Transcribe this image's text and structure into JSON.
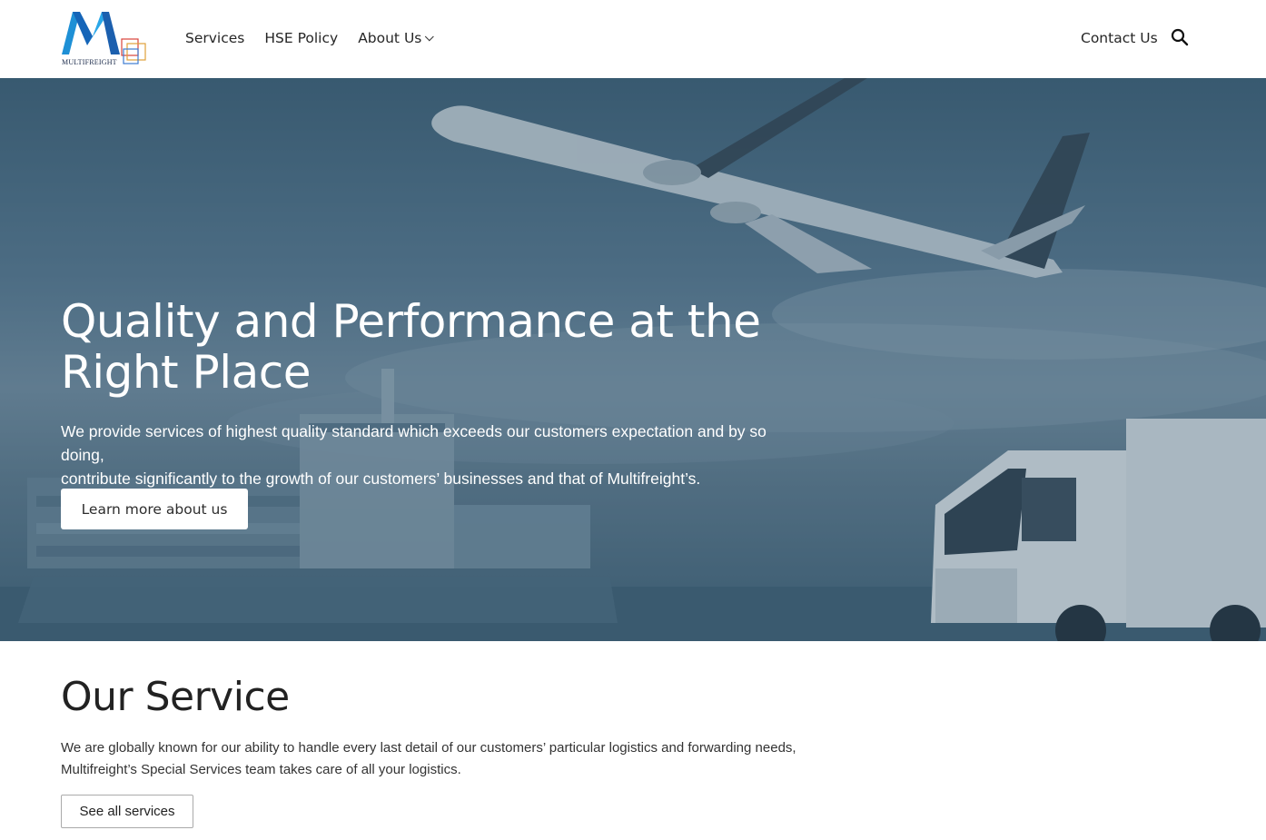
{
  "brand": {
    "logo_text": "MULTIFREIGHT"
  },
  "nav": {
    "items": [
      {
        "label": "Services"
      },
      {
        "label": "HSE Policy"
      },
      {
        "label": "About Us"
      }
    ],
    "contact_label": "Contact Us",
    "search_icon": "search-icon",
    "dropdown_icon": "chevron-down-icon"
  },
  "hero": {
    "title_line1": "Quality and Performance at the",
    "title_line2": "Right Place",
    "text_line1": "We provide services of highest quality standard which exceeds our customers expectation and by so doing,",
    "text_line2": "contribute significantly to the growth of our customers’ businesses and that of Multifreight’s.",
    "button_label": "Learn more about us"
  },
  "services": {
    "title": "Our Service",
    "text_line1": "We are globally known for our ability to handle every last detail of our customers’ particular logistics and forwarding needs,",
    "text_line2": "Multifreight’s Special Services team takes care of all your logistics.",
    "button_label": "See all services"
  },
  "colors": {
    "logo_blue": "#1e90d6",
    "logo_dark": "#1b2f6b",
    "hero_tint": "#4a6a80"
  }
}
